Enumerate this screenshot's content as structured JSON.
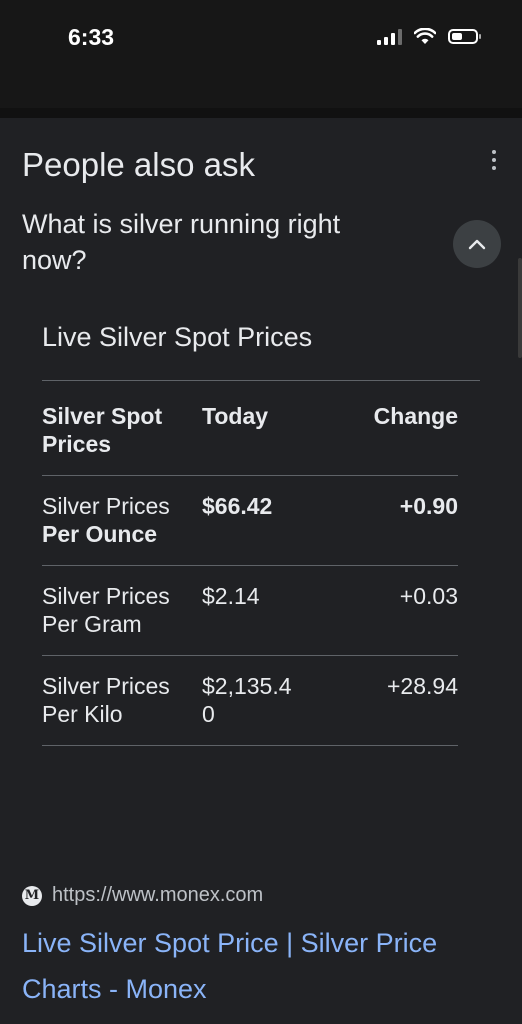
{
  "status_bar": {
    "time": "6:33"
  },
  "people_also_ask": {
    "title": "People also ask",
    "question": "What is silver running right now?",
    "answer": {
      "heading": "Live Silver Spot Prices",
      "columns": [
        "Silver Spot Prices",
        "Today",
        "Change"
      ],
      "rows": [
        {
          "label_plain": "Silver Prices ",
          "label_bold": "Per Ounce",
          "today": "$66.42",
          "change": "+0.90",
          "bold_values": true
        },
        {
          "label": "Silver Prices Per Gram",
          "today": "$2.14",
          "change": "+0.03"
        },
        {
          "label": "Silver Prices Per Kilo",
          "today": "$2,135.40",
          "change": "+28.94"
        }
      ]
    },
    "source": {
      "favicon_letter": "M",
      "url": "https://www.monex.com",
      "link_text": "Live Silver Spot Price | Silver Price Charts - Monex"
    }
  },
  "colors": {
    "background": "#202124",
    "text": "#e8eaed",
    "link": "#8ab4f8",
    "divider": "#5f6368"
  },
  "icons": [
    "signal-icon",
    "wifi-icon",
    "battery-icon",
    "more-options-icon",
    "chevron-up-icon",
    "monex-favicon"
  ]
}
